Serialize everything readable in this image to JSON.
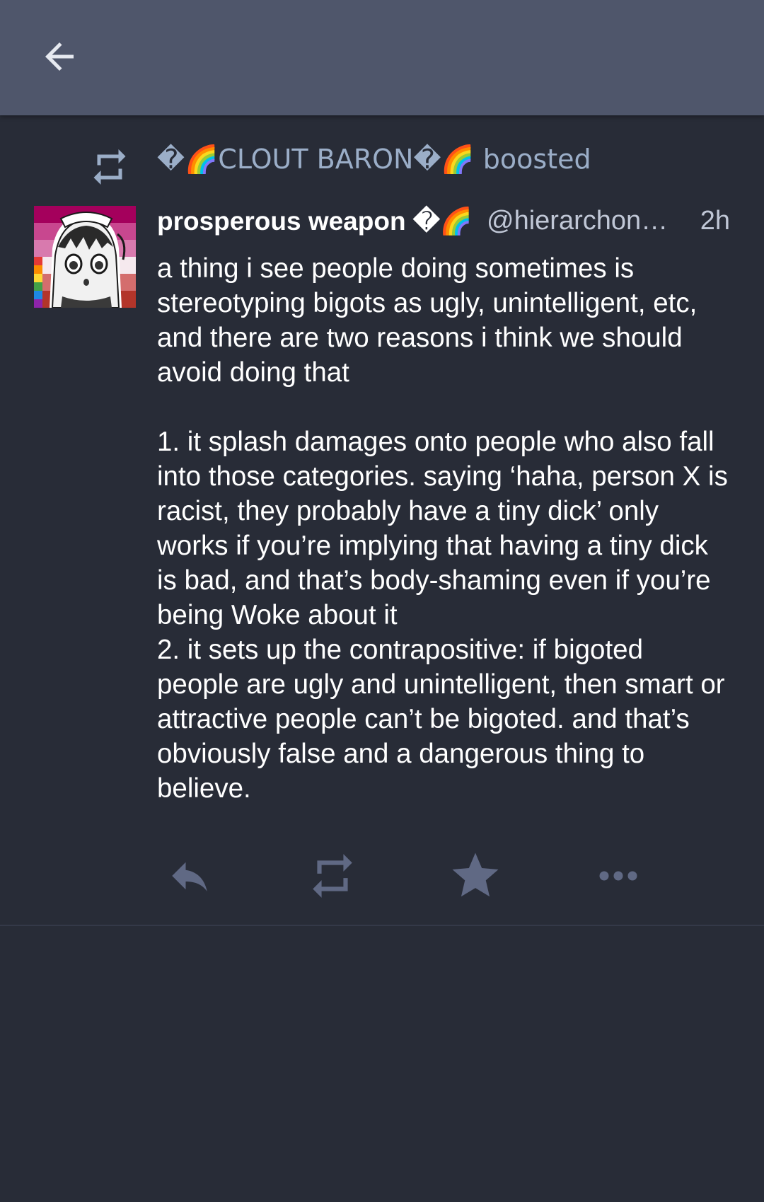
{
  "topbar": {
    "back_icon": "arrow-left-icon"
  },
  "boost": {
    "icon": "boost-icon",
    "text": "�🌈CLOUT BARON�🌈 boosted"
  },
  "status": {
    "display_name": "prosperous weapon �🌈",
    "handle": "@hierarchon…",
    "timestamp": "2h",
    "paragraphs": [
      "a thing i see people doing sometimes is stereotyping bigots as ugly, unintelligent, etc, and there are two reasons i think we should avoid doing that",
      "1. it splash damages onto people who also fall into those categories. saying ‘haha, person X is racist, they probably have a tiny dick’ only works if you’re implying that having a tiny dick is bad, and that’s body-shaming even if you’re being Woke about it\n2. it sets up the contrapositive: if bigoted people are ugly and unintelligent, then smart or attractive people can’t be bigoted. and that’s obviously false and a dangerous thing to believe."
    ]
  },
  "actions": {
    "reply_icon": "reply-icon",
    "boost_icon": "boost-icon",
    "favourite_icon": "star-icon",
    "more_icon": "more-icon"
  },
  "colors": {
    "topbar": "#4f566b",
    "background": "#282c37",
    "muted": "#9baec8",
    "action_icon": "#606984"
  }
}
